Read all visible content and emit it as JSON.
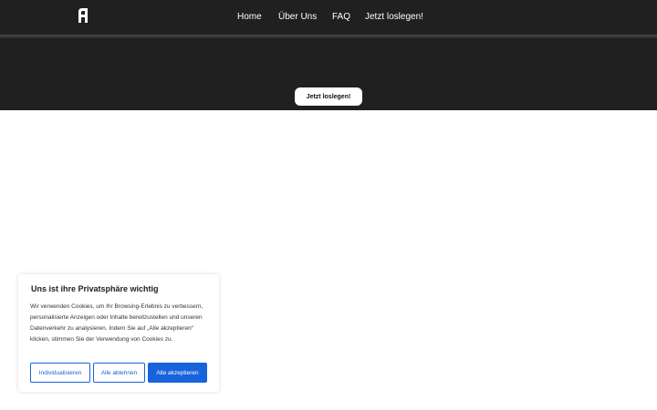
{
  "brand": {
    "logo_icon": "logo-a-icon",
    "header_color": "#202020"
  },
  "nav": {
    "items": [
      {
        "label": "Home"
      },
      {
        "label": "Über Uns"
      },
      {
        "label": "FAQ"
      },
      {
        "label": "Jetzt loslegen!"
      }
    ]
  },
  "hero": {
    "cta_label": "Jetzt loslegen!"
  },
  "cookie_banner": {
    "title": "Uns ist ihre Privatsphäre wichtig",
    "text": "Wir verwenden Cookies, um Ihr Browsing-Erlebnis zu verbessern, personalisierte Anzeigen oder Inhalte bereitzustellen und unseren Datenverkehr zu analysieren. Indem Sie auf „Alle akzeptieren“ klicken, stimmen Sie der Verwendung von Cookies zu.",
    "customize_label": "Individualisieren",
    "reject_label": "Alle ablehnen",
    "accept_label": "Alle akzeptieren",
    "accent_color": "#1863dc"
  }
}
